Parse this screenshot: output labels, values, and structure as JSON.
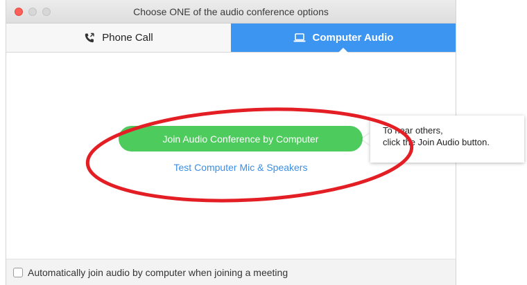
{
  "window": {
    "title": "Choose ONE of the audio conference options"
  },
  "tabs": [
    {
      "label": "Phone Call",
      "icon": "phone-icon",
      "selected": false
    },
    {
      "label": "Computer Audio",
      "icon": "laptop-icon",
      "selected": true
    }
  ],
  "main": {
    "join_button_label": "Join Audio Conference by Computer",
    "test_link_label": "Test Computer Mic & Speakers"
  },
  "tooltip": {
    "line1": "To hear others,",
    "line2": "click the Join Audio button."
  },
  "bottom": {
    "checkbox_label": "Automatically join audio by computer when joining a meeting",
    "checked": false
  },
  "colors": {
    "accent_blue": "#3d95f2",
    "join_green": "#4ecb5d",
    "link_blue": "#3a8ee6",
    "annotation_red": "#e31e24"
  }
}
